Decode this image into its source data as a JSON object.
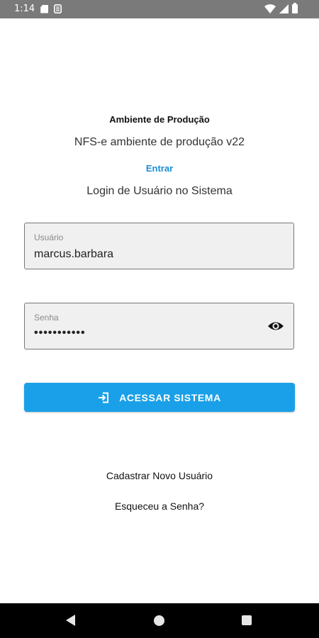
{
  "status_bar": {
    "time": "1:14",
    "icons": [
      "sd-card-icon",
      "sim-icon",
      "wifi-icon",
      "signal-icon",
      "battery-icon"
    ]
  },
  "header": {
    "environment_title": "Ambiente de Produção",
    "environment_subtitle": "NFS-e ambiente de produção v22",
    "enter_link": "Entrar",
    "login_heading": "Login de Usuário no Sistema"
  },
  "form": {
    "username": {
      "label": "Usuário",
      "value": "marcus.barbara"
    },
    "password": {
      "label": "Senha",
      "value": "•••••••••••",
      "toggle_icon": "eye-icon"
    },
    "submit": {
      "label": "ACESSAR SISTEMA",
      "icon": "login-icon"
    }
  },
  "links": {
    "register": "Cadastrar Novo Usuário",
    "forgot_password": "Esqueceu a Senha?"
  },
  "nav_bar": {
    "buttons": [
      "back",
      "home",
      "recents"
    ]
  },
  "colors": {
    "accent": "#1aa0e8",
    "link": "#1a8ed8",
    "status_bar": "#7a7a7a",
    "nav_bar": "#000000",
    "field_bg": "#f0f0f0"
  }
}
